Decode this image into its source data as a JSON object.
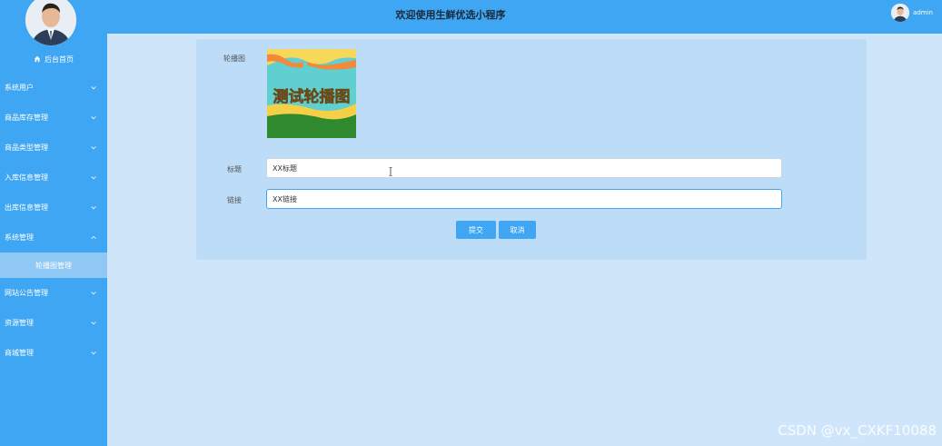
{
  "header": {
    "title": "欢迎使用生鲜优选小程序",
    "username": "admin"
  },
  "sidebar": {
    "home_label": "后台首页",
    "items": [
      {
        "label": "系统用户"
      },
      {
        "label": "商品库存管理"
      },
      {
        "label": "商品类型管理"
      },
      {
        "label": "入库信息管理"
      },
      {
        "label": "出库信息管理"
      },
      {
        "label": "系统管理"
      },
      {
        "label": "网站公告管理"
      },
      {
        "label": "资源管理"
      },
      {
        "label": "商城管理"
      }
    ],
    "active_submenu": "轮播图管理"
  },
  "form": {
    "image_label": "轮播图",
    "image_text": "测试轮播图",
    "title_label": "标题",
    "title_value": "XX标题",
    "link_label": "链接",
    "link_value": "XX链接",
    "submit_label": "提交",
    "cancel_label": "取消"
  },
  "watermark": "CSDN @vx_CXKF10088",
  "colors": {
    "sidebar": "#3ea6f2",
    "header": "#3ea6f2",
    "background": "#cfe6fa",
    "panel": "#bcdcf7",
    "button": "#3ea6f2"
  }
}
